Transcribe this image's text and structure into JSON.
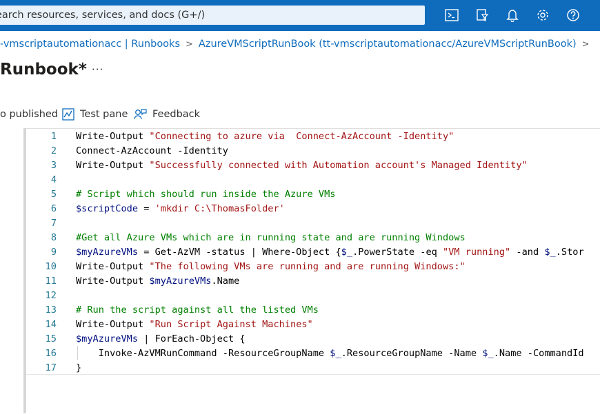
{
  "topbar": {
    "search_placeholder": "earch resources, services, and docs (G+/)",
    "icons": [
      "cloud-shell-icon",
      "directory-filter-icon",
      "notifications-bell-icon",
      "settings-gear-icon",
      "help-question-icon"
    ]
  },
  "breadcrumb": {
    "items": [
      "-vmscriptautomationacc | Runbooks",
      "AzureVMScriptRunBook (tt-vmscriptautomationacc/AzureVMScriptRunBook)"
    ]
  },
  "page": {
    "title": "Runbook*",
    "more": "···"
  },
  "toolbar": {
    "revert_label": "o published",
    "test_pane_label": "Test pane",
    "feedback_label": "Feedback"
  },
  "editor": {
    "line_numbers": [
      "1",
      "2",
      "3",
      "4",
      "5",
      "6",
      "7",
      "8",
      "9",
      "10",
      "11",
      "12",
      "13",
      "14",
      "15",
      "16",
      "17"
    ],
    "lines": [
      [
        {
          "t": "plain",
          "v": "Write-Output "
        },
        {
          "t": "str",
          "v": "\"Connecting to azure via  Connect-AzAccount -Identity\""
        }
      ],
      [
        {
          "t": "plain",
          "v": "Connect-AzAccount -Identity"
        }
      ],
      [
        {
          "t": "plain",
          "v": "Write-Output "
        },
        {
          "t": "str",
          "v": "\"Successfully connected with Automation account's Managed Identity\""
        }
      ],
      [],
      [
        {
          "t": "cmt",
          "v": "# Script which should run inside the Azure VMs"
        }
      ],
      [
        {
          "t": "var",
          "v": "$scriptCode"
        },
        {
          "t": "plain",
          "v": " = "
        },
        {
          "t": "str",
          "v": "'mkdir C:\\ThomasFolder'"
        }
      ],
      [],
      [
        {
          "t": "cmt",
          "v": "#Get all Azure VMs which are in running state and are running Windows"
        }
      ],
      [
        {
          "t": "var",
          "v": "$myAzureVMs"
        },
        {
          "t": "plain",
          "v": " = Get-AzVM -status | Where-Object {"
        },
        {
          "t": "var",
          "v": "$_"
        },
        {
          "t": "plain",
          "v": ".PowerState -eq "
        },
        {
          "t": "str",
          "v": "\"VM running\""
        },
        {
          "t": "plain",
          "v": " -and "
        },
        {
          "t": "var",
          "v": "$_"
        },
        {
          "t": "plain",
          "v": ".Stor"
        }
      ],
      [
        {
          "t": "plain",
          "v": "Write-Output "
        },
        {
          "t": "str",
          "v": "\"The following VMs are running and are running Windows:\""
        }
      ],
      [
        {
          "t": "plain",
          "v": "Write-Output "
        },
        {
          "t": "var",
          "v": "$myAzureVMs"
        },
        {
          "t": "plain",
          "v": ".Name"
        }
      ],
      [],
      [
        {
          "t": "cmt",
          "v": "# Run the script against all the listed VMs"
        }
      ],
      [
        {
          "t": "plain",
          "v": "Write-Output "
        },
        {
          "t": "str",
          "v": "\"Run Script Against Machines\""
        }
      ],
      [
        {
          "t": "var",
          "v": "$myAzureVMs"
        },
        {
          "t": "plain",
          "v": " | ForEach-Object {"
        }
      ],
      [
        {
          "t": "plain",
          "v": "    Invoke-AzVMRunCommand -ResourceGroupName "
        },
        {
          "t": "var",
          "v": "$_"
        },
        {
          "t": "plain",
          "v": ".ResourceGroupName -Name "
        },
        {
          "t": "var",
          "v": "$_"
        },
        {
          "t": "plain",
          "v": ".Name -CommandId"
        }
      ],
      [
        {
          "t": "plain",
          "v": "}"
        }
      ]
    ]
  },
  "colors": {
    "topbar": "#0f6cbd",
    "link": "#0f6cbd",
    "string": "#a31515",
    "comment": "#008000",
    "variable": "#001080",
    "line_number": "#237893"
  }
}
